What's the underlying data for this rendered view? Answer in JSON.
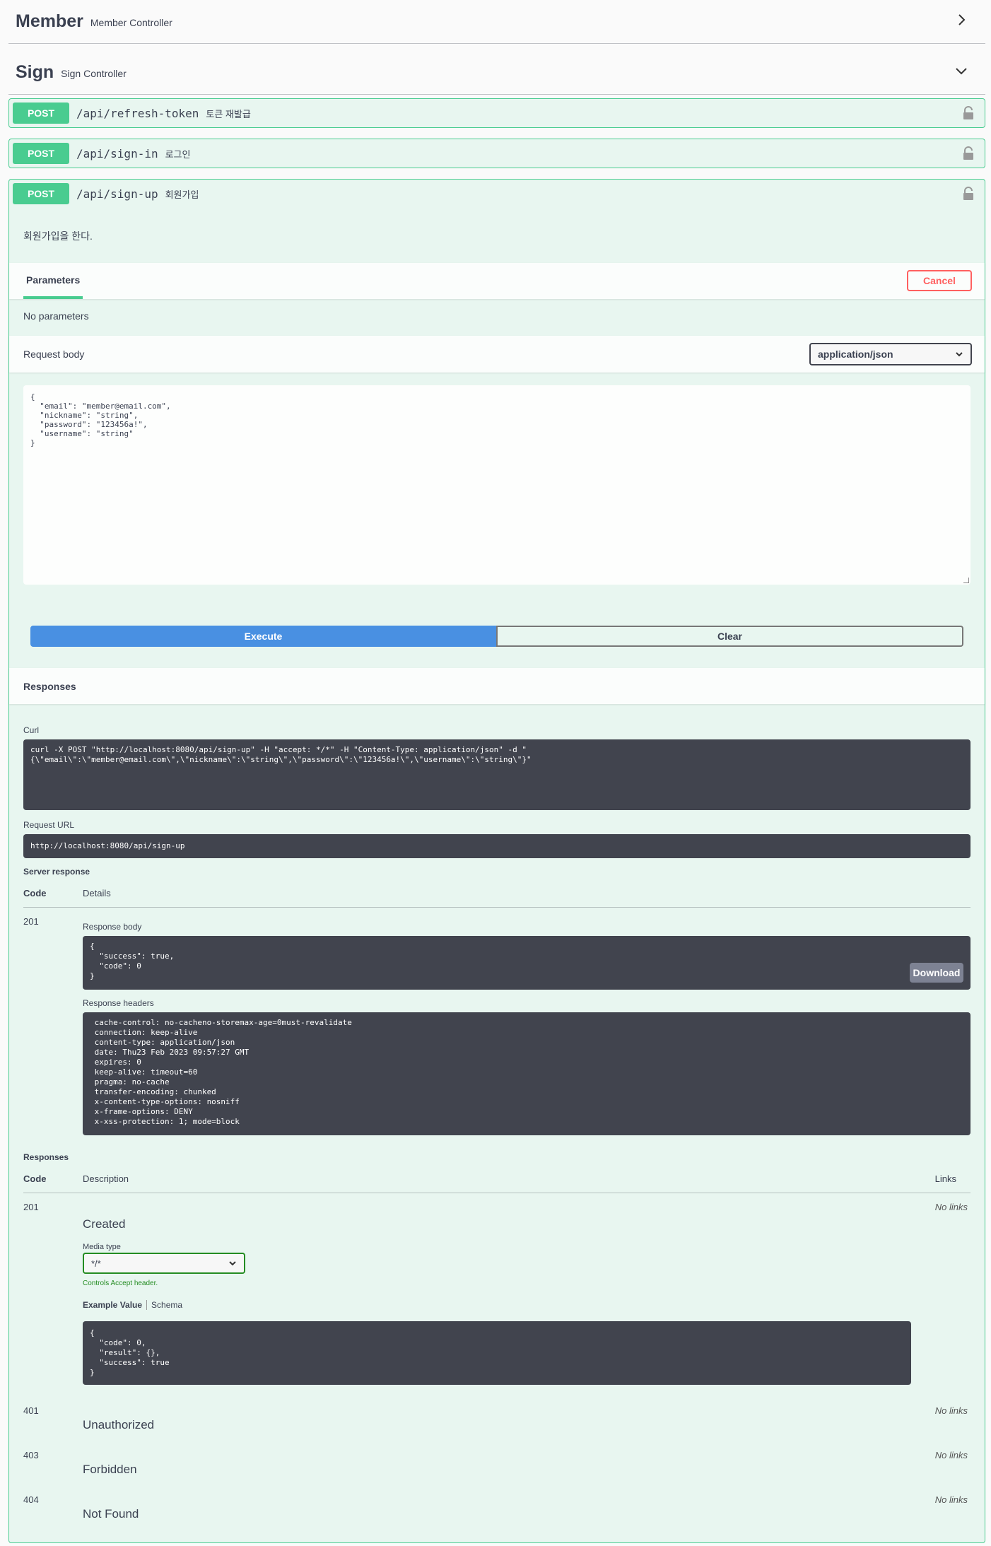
{
  "tags": [
    {
      "name": "Member",
      "description": "Member Controller"
    },
    {
      "name": "Sign",
      "description": "Sign Controller"
    }
  ],
  "operations": [
    {
      "method": "POST",
      "path": "/api/refresh-token",
      "summary": "토큰 재발급"
    },
    {
      "method": "POST",
      "path": "/api/sign-in",
      "summary": "로그인"
    },
    {
      "method": "POST",
      "path": "/api/sign-up",
      "summary": "회원가입"
    }
  ],
  "expanded": {
    "description": "회원가입을 한다.",
    "parameters_tab": "Parameters",
    "cancel_label": "Cancel",
    "no_parameters": "No parameters",
    "request_body_label": "Request body",
    "content_type": "application/json",
    "request_body": "{\n  \"email\": \"member@email.com\",\n  \"nickname\": \"string\",\n  \"password\": \"123456a!\",\n  \"username\": \"string\"\n}",
    "execute_label": "Execute",
    "clear_label": "Clear",
    "responses_title": "Responses",
    "curl_label": "Curl",
    "curl": "curl -X POST \"http://localhost:8080/api/sign-up\" -H \"accept: */*\" -H \"Content-Type: application/json\" -d \"\n{\\\"email\\\":\\\"member@email.com\\\",\\\"nickname\\\":\\\"string\\\",\\\"password\\\":\\\"123456a!\\\",\\\"username\\\":\\\"string\\\"}\"",
    "request_url_label": "Request URL",
    "request_url": "http://localhost:8080/api/sign-up",
    "server_response_label": "Server response",
    "code_header": "Code",
    "details_header": "Details",
    "server_code": "201",
    "response_body_label": "Response body",
    "response_body": "{\n  \"success\": true,\n  \"code\": 0\n}",
    "download_label": "Download",
    "response_headers_label": "Response headers",
    "response_headers": " cache-control: no-cacheno-storemax-age=0must-revalidate\n connection: keep-alive\n content-type: application/json\n date: Thu23 Feb 2023 09:57:27 GMT\n expires: 0\n keep-alive: timeout=60\n pragma: no-cache\n transfer-encoding: chunked\n x-content-type-options: nosniff\n x-frame-options: DENY\n x-xss-protection: 1; mode=block",
    "responses_label": "Responses",
    "description_header": "Description",
    "links_header": "Links",
    "media_type_label": "Media type",
    "media_type": "*/*",
    "controls_accept": "Controls Accept header.",
    "example_value_tab": "Example Value",
    "schema_tab": "Schema",
    "example_value": "{\n  \"code\": 0,\n  \"result\": {},\n  \"success\": true\n}",
    "no_links": "No links",
    "responses": [
      {
        "code": "201",
        "description": "Created"
      },
      {
        "code": "401",
        "description": "Unauthorized"
      },
      {
        "code": "403",
        "description": "Forbidden"
      },
      {
        "code": "404",
        "description": "Not Found"
      }
    ]
  },
  "colors": {
    "post": "#49cc90",
    "execute": "#4990e2",
    "cancel": "#ff6060",
    "dark_block": "#41444e"
  }
}
